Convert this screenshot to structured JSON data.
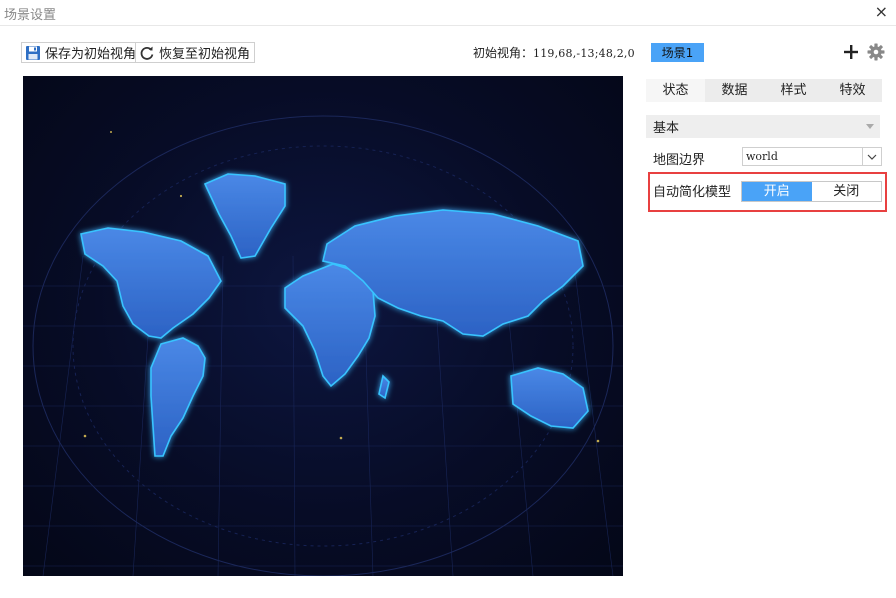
{
  "window": {
    "title": "场景设置",
    "close_glyph": "×"
  },
  "toolbar": {
    "save_label": "保存为初始视角",
    "save_icon": "save-icon",
    "restore_label": "恢复至初始视角",
    "restore_icon": "refresh-icon",
    "view_prefix": "初始视角：",
    "view_value": "119,68,-13;48,2,0",
    "scene_label": "场景1",
    "add_icon": "plus-icon",
    "settings_icon": "gear-icon"
  },
  "tabs": [
    {
      "label": "状态",
      "active": true
    },
    {
      "label": "数据",
      "active": false
    },
    {
      "label": "样式",
      "active": false
    },
    {
      "label": "特效",
      "active": false
    }
  ],
  "panel": {
    "section_title": "基本",
    "boundary_label": "地图边界",
    "boundary_value": "world",
    "simplify_label": "自动简化模型",
    "simplify_on": "开启",
    "simplify_off": "关闭",
    "simplify_selected": "开启"
  },
  "colors": {
    "accent": "#4aa3f7",
    "highlight_border": "#e84040",
    "map_bg": "#070c26",
    "map_land": "#3a78d8",
    "map_glow": "#39c4ff"
  }
}
